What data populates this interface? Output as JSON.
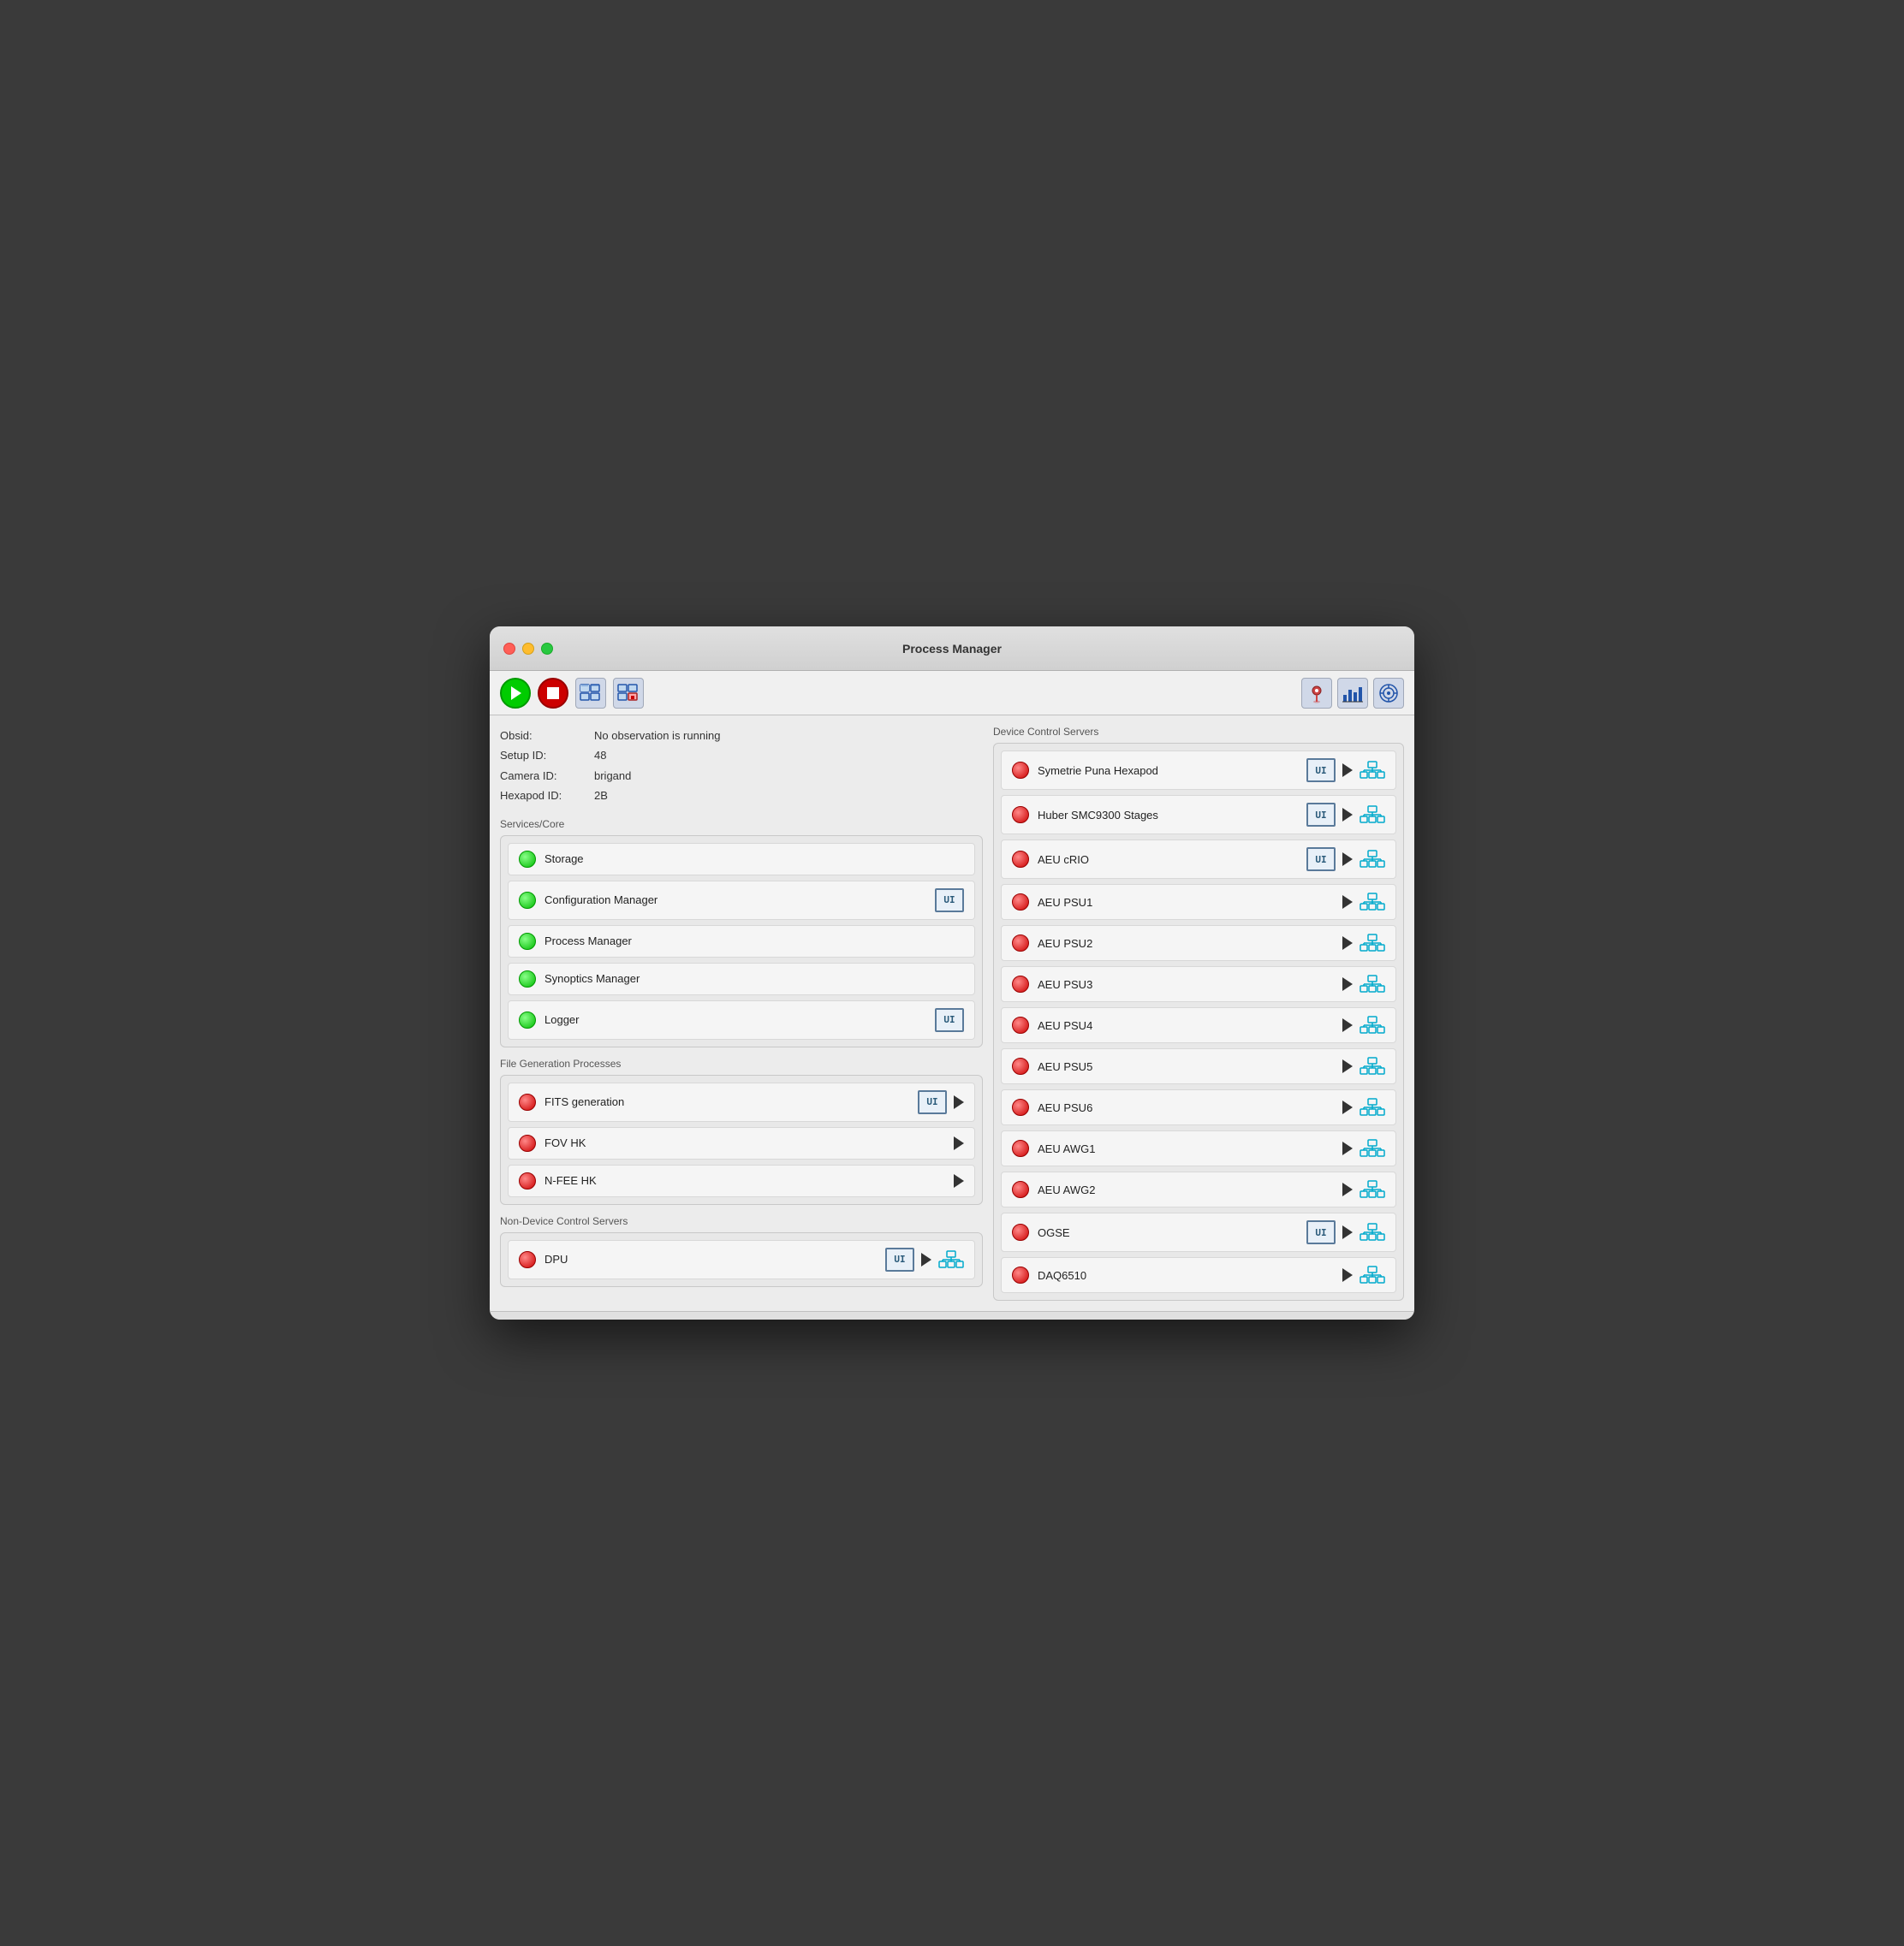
{
  "window": {
    "title": "Process Manager"
  },
  "toolbar": {
    "play_label": "▶",
    "stop_label": "■",
    "icon1_label": "🖥",
    "icon2_label": "🖥"
  },
  "info": {
    "obsid_label": "Obsid:",
    "obsid_value": "No observation is running",
    "setup_id_label": "Setup ID:",
    "setup_id_value": "48",
    "camera_id_label": "Camera ID:",
    "camera_id_value": "brigand",
    "hexapod_id_label": "Hexapod ID:",
    "hexapod_id_value": "2B"
  },
  "services_core": {
    "section_label": "Services/Core",
    "items": [
      {
        "name": "Storage",
        "status": "green",
        "has_ui": false,
        "has_play": false,
        "has_network": false
      },
      {
        "name": "Configuration Manager",
        "status": "green",
        "has_ui": true,
        "has_play": false,
        "has_network": false
      },
      {
        "name": "Process Manager",
        "status": "green",
        "has_ui": false,
        "has_play": false,
        "has_network": false
      },
      {
        "name": "Synoptics Manager",
        "status": "green",
        "has_ui": false,
        "has_play": false,
        "has_network": false
      },
      {
        "name": "Logger",
        "status": "green",
        "has_ui": true,
        "has_play": false,
        "has_network": false
      }
    ]
  },
  "file_generation": {
    "section_label": "File Generation Processes",
    "items": [
      {
        "name": "FITS generation",
        "status": "red",
        "has_ui": true,
        "has_play": true,
        "has_network": false
      },
      {
        "name": "FOV HK",
        "status": "red",
        "has_ui": false,
        "has_play": true,
        "has_network": false
      },
      {
        "name": "N-FEE HK",
        "status": "red",
        "has_ui": false,
        "has_play": true,
        "has_network": false
      }
    ]
  },
  "non_device_servers": {
    "section_label": "Non-Device Control Servers",
    "items": [
      {
        "name": "DPU",
        "status": "red",
        "has_ui": true,
        "has_play": true,
        "has_network": true
      }
    ]
  },
  "device_control_servers": {
    "section_label": "Device Control Servers",
    "items": [
      {
        "name": "Symetrie Puna Hexapod",
        "status": "red",
        "has_ui": true,
        "has_play": true,
        "has_network": true
      },
      {
        "name": "Huber SMC9300 Stages",
        "status": "red",
        "has_ui": true,
        "has_play": true,
        "has_network": true
      },
      {
        "name": "AEU cRIO",
        "status": "red",
        "has_ui": true,
        "has_play": true,
        "has_network": true
      },
      {
        "name": "AEU PSU1",
        "status": "red",
        "has_ui": false,
        "has_play": true,
        "has_network": true
      },
      {
        "name": "AEU PSU2",
        "status": "red",
        "has_ui": false,
        "has_play": true,
        "has_network": true
      },
      {
        "name": "AEU PSU3",
        "status": "red",
        "has_ui": false,
        "has_play": true,
        "has_network": true
      },
      {
        "name": "AEU PSU4",
        "status": "red",
        "has_ui": false,
        "has_play": true,
        "has_network": true
      },
      {
        "name": "AEU PSU5",
        "status": "red",
        "has_ui": false,
        "has_play": true,
        "has_network": true
      },
      {
        "name": "AEU PSU6",
        "status": "red",
        "has_ui": false,
        "has_play": true,
        "has_network": true
      },
      {
        "name": "AEU AWG1",
        "status": "red",
        "has_ui": false,
        "has_play": true,
        "has_network": true
      },
      {
        "name": "AEU AWG2",
        "status": "red",
        "has_ui": false,
        "has_play": true,
        "has_network": true
      },
      {
        "name": "OGSE",
        "status": "red",
        "has_ui": true,
        "has_play": true,
        "has_network": true
      },
      {
        "name": "DAQ6510",
        "status": "red",
        "has_ui": false,
        "has_play": true,
        "has_network": true
      }
    ]
  },
  "ui_label": "UI"
}
